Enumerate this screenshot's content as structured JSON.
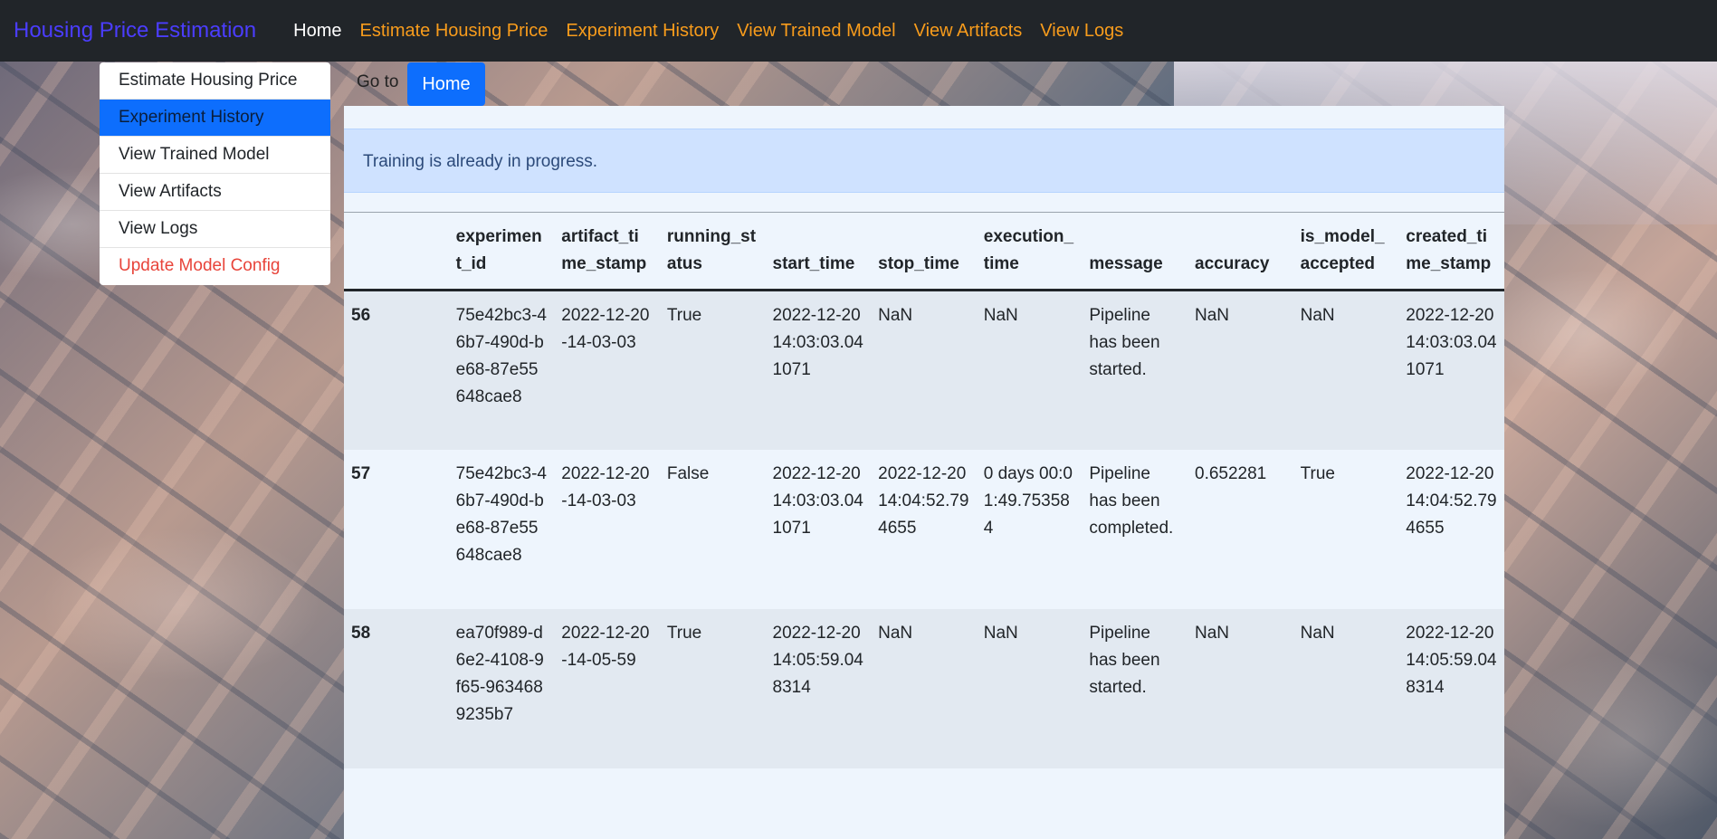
{
  "navbar": {
    "brand": "Housing Price Estimation",
    "links": [
      {
        "label": "Home"
      },
      {
        "label": "Estimate Housing Price"
      },
      {
        "label": "Experiment History"
      },
      {
        "label": "View Trained Model"
      },
      {
        "label": "View Artifacts"
      },
      {
        "label": "View Logs"
      }
    ],
    "colors": {
      "brand": "#4b3dff",
      "link": "#f89c1c",
      "active": "#ffffff",
      "bar": "#212529"
    }
  },
  "dropdown": {
    "items": [
      {
        "label": "Estimate Housing Price"
      },
      {
        "label": "Experiment History"
      },
      {
        "label": "View Trained Model"
      },
      {
        "label": "View Artifacts"
      },
      {
        "label": "View Logs"
      },
      {
        "label": "Update Model Config"
      }
    ]
  },
  "goto": {
    "label": "Go to",
    "button": "Home"
  },
  "alert": {
    "message": "Training is already in progress."
  },
  "table": {
    "headers": [
      "",
      "experiment_id",
      "artifact_time_stamp",
      "running_status",
      "start_time",
      "stop_time",
      "execution_time",
      "message",
      "accuracy",
      "is_model_accepted",
      "created_time_stamp"
    ],
    "rows": [
      [
        "56",
        "75e42bc3-46b7-490d-be68-87e55648cae8",
        "2022-12-20-14-03-03",
        "True",
        "2022-12-20 14:03:03.041071",
        "NaN",
        "NaN",
        "Pipeline has been started.",
        "NaN",
        "NaN",
        "2022-12-20 14:03:03.041071"
      ],
      [
        "57",
        "75e42bc3-46b7-490d-be68-87e55648cae8",
        "2022-12-20-14-03-03",
        "False",
        "2022-12-20 14:03:03.041071",
        "2022-12-20 14:04:52.794655",
        "0 days 00:01:49.753584",
        "Pipeline has been completed.",
        "0.652281",
        "True",
        "2022-12-20 14:04:52.794655"
      ],
      [
        "58",
        "ea70f989-d6e2-4108-9f65-9634689235b7",
        "2022-12-20-14-05-59",
        "True",
        "2022-12-20 14:05:59.048314",
        "NaN",
        "NaN",
        "Pipeline has been started.",
        "NaN",
        "NaN",
        "2022-12-20 14:05:59.048314"
      ]
    ]
  }
}
